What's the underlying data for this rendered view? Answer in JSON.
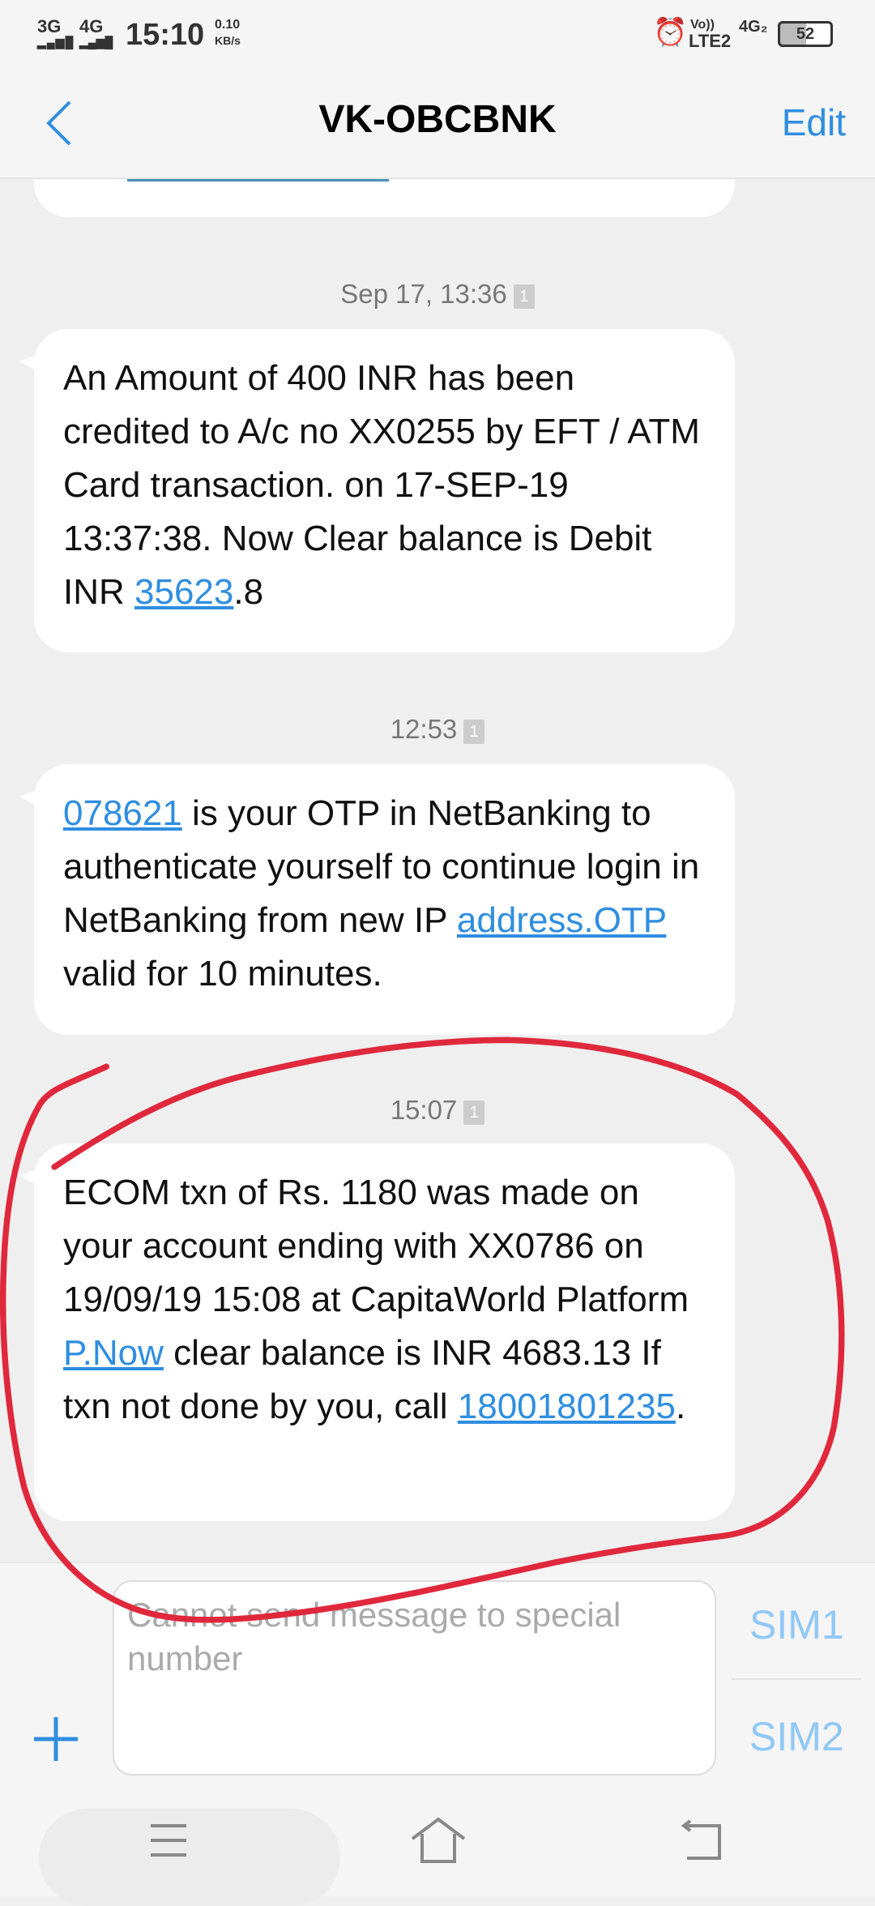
{
  "status_bar": {
    "net1": "3G",
    "net2": "4G",
    "time": "15:10",
    "speed_value": "0.10",
    "speed_unit": "KB/s",
    "volte": "Vo))",
    "lte": "LTE2",
    "net3": "4G₂",
    "battery": "52"
  },
  "header": {
    "title": "VK-OBCBNK",
    "edit_label": "Edit"
  },
  "messages": [
    {
      "timestamp": "Sep 17, 13:36",
      "sim": "1",
      "parts": {
        "a": "An Amount of 400 INR has been credited to A/c no XX0255 by EFT / ATM Card transaction. on 17-SEP-19 13:37:38. Now Clear balance is Debit INR ",
        "link": "35623",
        ".b": "",
        "b": ".8"
      }
    },
    {
      "timestamp": "12:53",
      "sim": "1",
      "parts": {
        "link1": "078621",
        "a": " is your OTP in NetBanking to authenticate yourself to continue login in NetBanking from new IP ",
        "link2": "address.OTP",
        "b": " valid for 10 minutes."
      }
    },
    {
      "timestamp": "15:07",
      "sim": "1",
      "parts": {
        "a": "ECOM txn of Rs. 1180 was made on your account ending with XX0786 on 19/09/19 15:08 at CapitaWorld Platform ",
        "link1": "P.Now",
        "b": " clear balance is INR 4683.13 If txn not done by you, call ",
        "link2": "18001801235",
        "c": "."
      }
    }
  ],
  "composer": {
    "placeholder": "Cannot send message to special number",
    "sim1": "SIM1",
    "sim2": "SIM2"
  },
  "colors": {
    "accent": "#2f8ee0",
    "annotation": "#e0283c"
  }
}
